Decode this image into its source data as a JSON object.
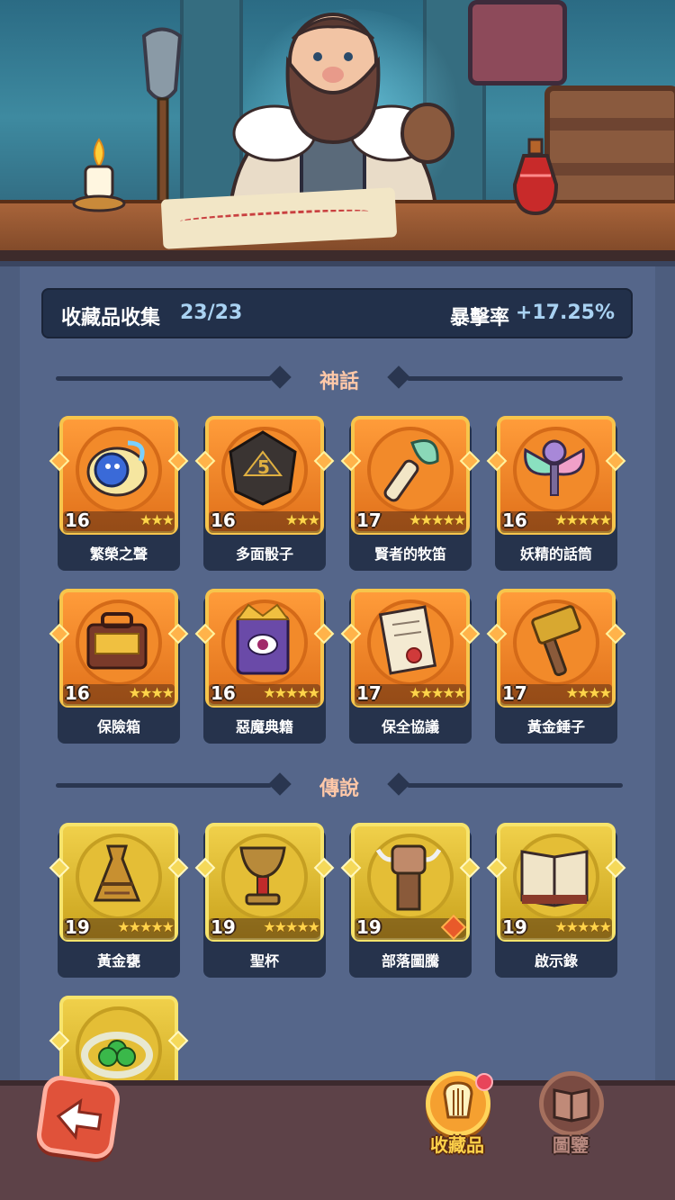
{
  "summary": {
    "label": "收藏品收集",
    "count": "23/23",
    "rate_label": "暴擊率",
    "rate_value": "+17.25%"
  },
  "sections": [
    {
      "title": "神話",
      "rarity": "myth",
      "items": [
        {
          "name": "繁榮之聲",
          "level": "16",
          "stars": 3,
          "icon": "blue-spirit-icon"
        },
        {
          "name": "多面骰子",
          "level": "16",
          "stars": 3,
          "icon": "dice-icon"
        },
        {
          "name": "賢者的牧笛",
          "level": "17",
          "stars": 5,
          "icon": "feather-flute-icon"
        },
        {
          "name": "妖精的話筒",
          "level": "16",
          "stars": 5,
          "icon": "fairy-microphone-icon"
        },
        {
          "name": "保險箱",
          "level": "16",
          "stars": 4,
          "icon": "treasure-chest-icon"
        },
        {
          "name": "惡魔典籍",
          "level": "16",
          "stars": 5,
          "icon": "demon-book-icon"
        },
        {
          "name": "保全協議",
          "level": "17",
          "stars": 5,
          "icon": "scroll-contract-icon"
        },
        {
          "name": "黃金錘子",
          "level": "17",
          "stars": 4,
          "icon": "golden-hammer-icon"
        }
      ]
    },
    {
      "title": "傳說",
      "rarity": "leg",
      "items": [
        {
          "name": "黃金甕",
          "level": "19",
          "stars": 5,
          "icon": "golden-urn-icon"
        },
        {
          "name": "聖杯",
          "level": "19",
          "stars": 5,
          "icon": "holy-grail-icon"
        },
        {
          "name": "部落圖騰",
          "level": "19",
          "stars": 0,
          "icon": "tribal-totem-icon"
        },
        {
          "name": "啟示錄",
          "level": "19",
          "stars": 5,
          "icon": "open-book-icon"
        },
        {
          "name": "",
          "level": "",
          "stars": 0,
          "icon": "clover-ring-icon"
        }
      ]
    }
  ],
  "nav": {
    "collection_label": "收藏品",
    "codex_label": "圖鑒"
  },
  "colors": {
    "myth_frame": "#f28a2a",
    "legend_frame": "#e4be36",
    "panel": "#55668a",
    "summary_bg": "#22304a",
    "accent_blue": "#a9d2f2"
  }
}
